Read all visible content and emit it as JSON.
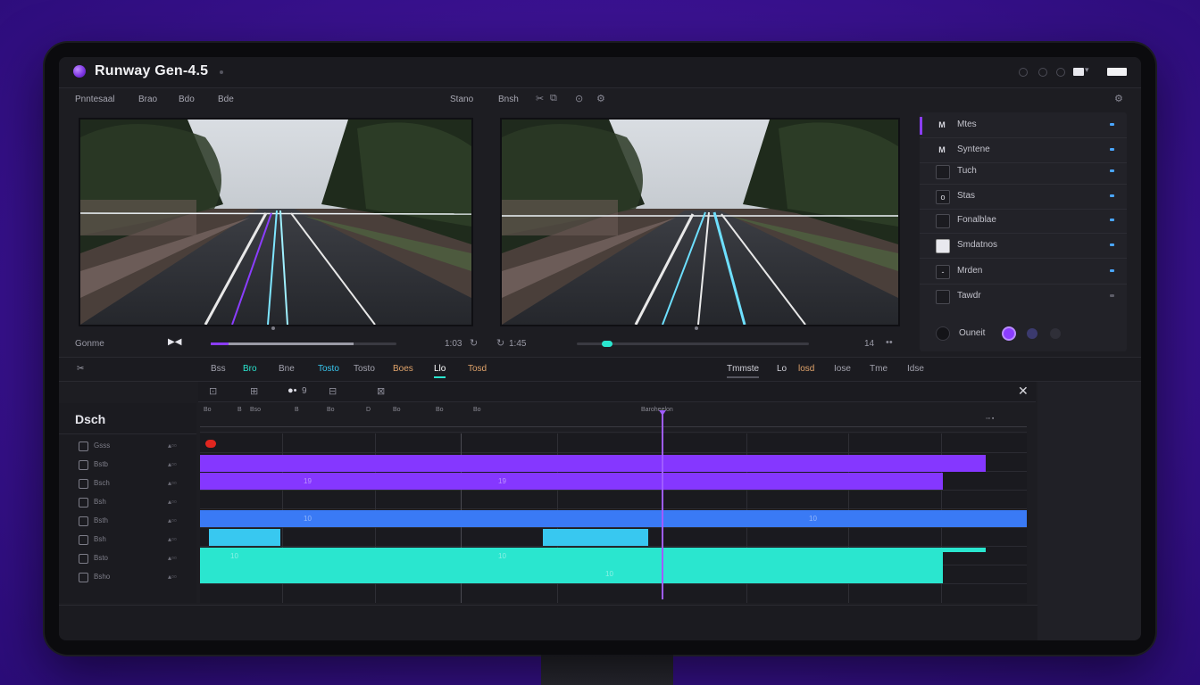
{
  "app": {
    "title": "Runway Gen-4.5"
  },
  "menu": {
    "left_items": [
      "Pnntesaal",
      "Brao",
      "Bdo",
      "Bde"
    ],
    "center_label": "Stano",
    "right_label": "Bnsh"
  },
  "previews": {
    "left_label": "Gonme",
    "left_time": "1:03",
    "right_time": "1:45",
    "right_label": "14"
  },
  "side_panel": {
    "items": [
      {
        "icon": "M",
        "label": "Mtes"
      },
      {
        "icon": "M",
        "label": "Syntene"
      },
      {
        "icon": "",
        "label": "Tuch"
      },
      {
        "icon": "o",
        "label": "Stas"
      },
      {
        "icon": "",
        "label": "Fonalblae"
      },
      {
        "icon": "",
        "label": "Smdatnos"
      },
      {
        "icon": "-",
        "label": "Mrden"
      },
      {
        "icon": "",
        "label": "Tawdr"
      }
    ],
    "footer_label": "Ouneit",
    "colors": [
      "#8b3dff",
      "#3b3a6e",
      "#2f2f38"
    ]
  },
  "tabs": {
    "left": [
      "Bss",
      "Bro",
      "Bne",
      "Tosto",
      "Boes",
      "Llo",
      "Tosd"
    ],
    "active": "Llo",
    "right": [
      "Tmmste",
      "Lo",
      "losd",
      "Iose",
      "Tme",
      "Idse"
    ]
  },
  "timeline": {
    "toolbar": [
      "B",
      "B",
      "9",
      "B",
      "B"
    ],
    "section_title": "Dsch",
    "ruler_labels": [
      "Bo",
      "B",
      "Bso",
      "B",
      "Bo",
      "D",
      "Bo",
      "Bo",
      "Bo",
      "Baroheelon"
    ],
    "layers": [
      "Gsss",
      "Bstb",
      "Bsch",
      "Bsh",
      "Bsth",
      "Bsh",
      "Bsto",
      "Bsho"
    ],
    "clip_labels": [
      "19",
      "19",
      "10",
      "10",
      "10",
      "10",
      "10"
    ]
  },
  "colors": {
    "accent": "#8b3dff",
    "purple_clip": "#8537ff",
    "blue_clip": "#3a7af5",
    "cyan_clip": "#38c8f0",
    "teal_clip": "#2ae6cf",
    "record": "#e0261f"
  },
  "icons": [
    "close-icon",
    "record-icon",
    "scissors-icon",
    "settings-icon"
  ]
}
